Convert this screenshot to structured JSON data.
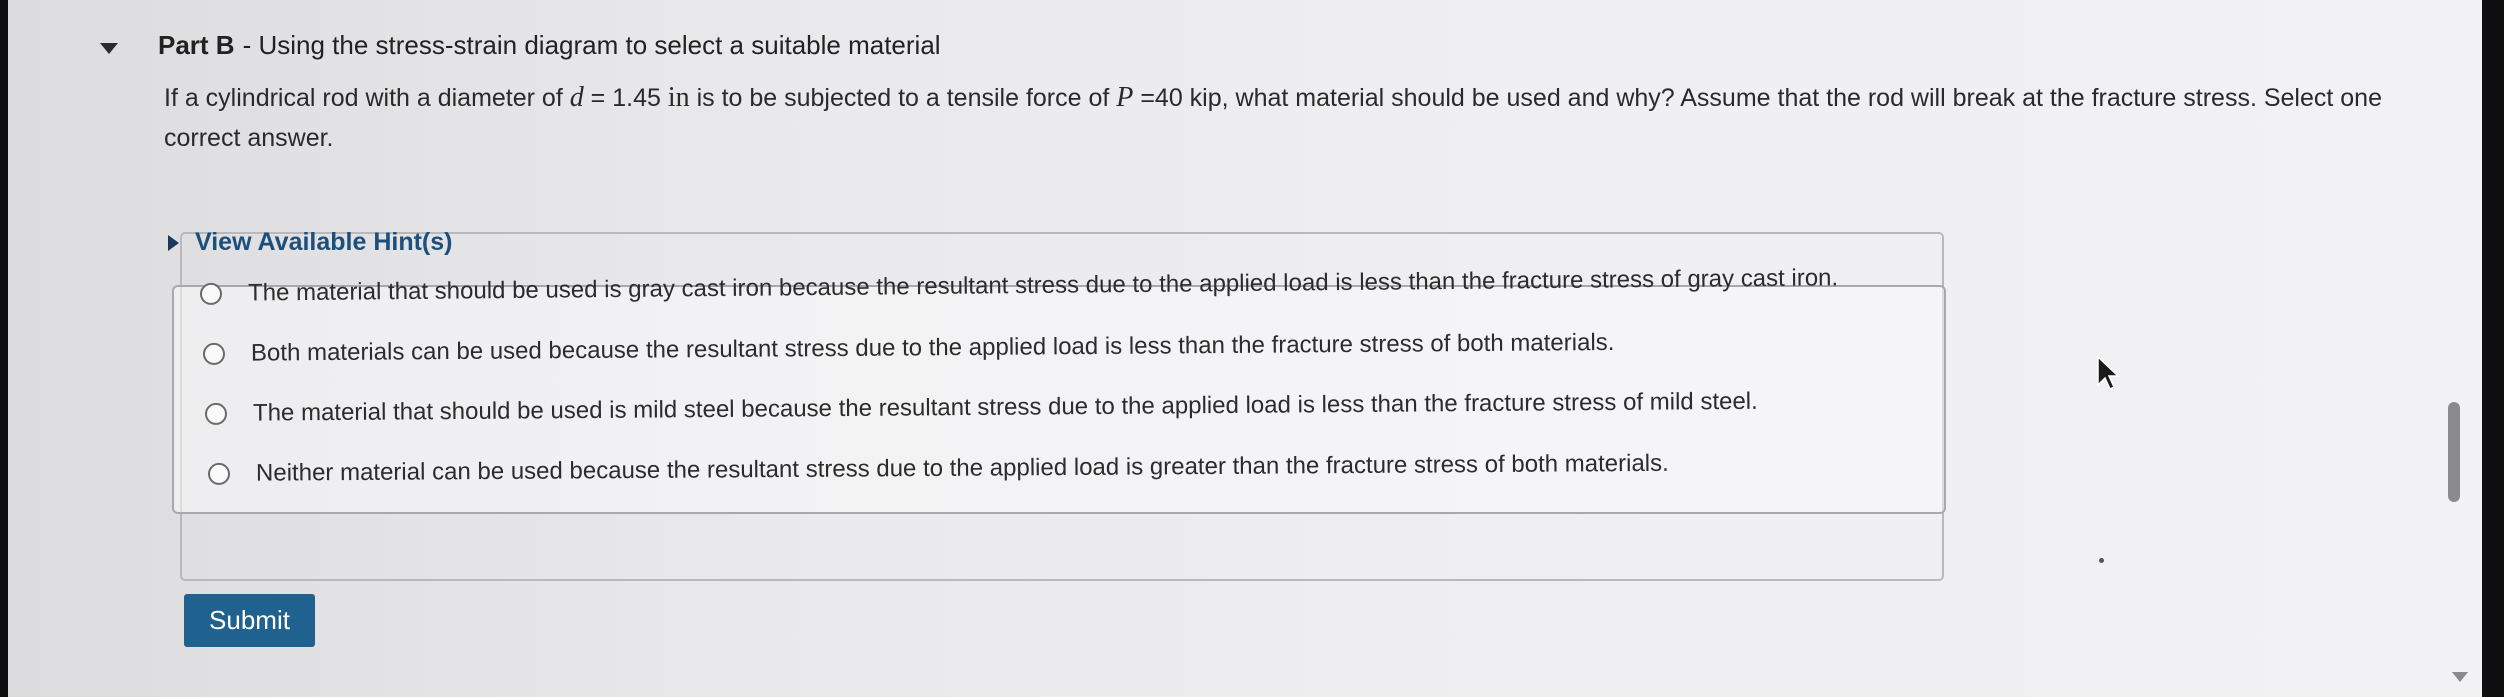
{
  "part": {
    "label": "Part B",
    "separator": "-",
    "title": "Using the stress-strain diagram to select a suitable material"
  },
  "question": {
    "text_1": "If a cylindrical rod with a diameter of ",
    "var_d": "d",
    "text_2": " = 1.45 ",
    "unit_in": "in",
    "text_3": " is to be subjected to a tensile force of ",
    "var_P": "P",
    "text_4": " =40 kip, what material should be used and why? Assume that the rod will break at the fracture stress. Select one correct answer."
  },
  "hints": {
    "label": "View Available Hint(s)"
  },
  "choices": [
    {
      "label": "The material that should be used is gray cast iron because the resultant stress due to the applied load is less than the fracture stress of gray cast iron."
    },
    {
      "label": "Both materials can be used because the resultant stress due to the applied load is less than the fracture stress of both materials."
    },
    {
      "label": "The material that should be used is mild steel because the resultant stress due to the applied load is less than the fracture stress of mild steel."
    },
    {
      "label": "Neither material can be used because the resultant stress due to the applied load is greater than the fracture stress of both materials."
    }
  ],
  "actions": {
    "submit_label": "Submit"
  },
  "colors": {
    "submit_bg": "#20628f",
    "hint_text": "#1d4f7c"
  },
  "icons": {
    "collapse": "caret-down-icon",
    "hint": "caret-right-icon",
    "cursor": "mouse-pointer-icon"
  }
}
